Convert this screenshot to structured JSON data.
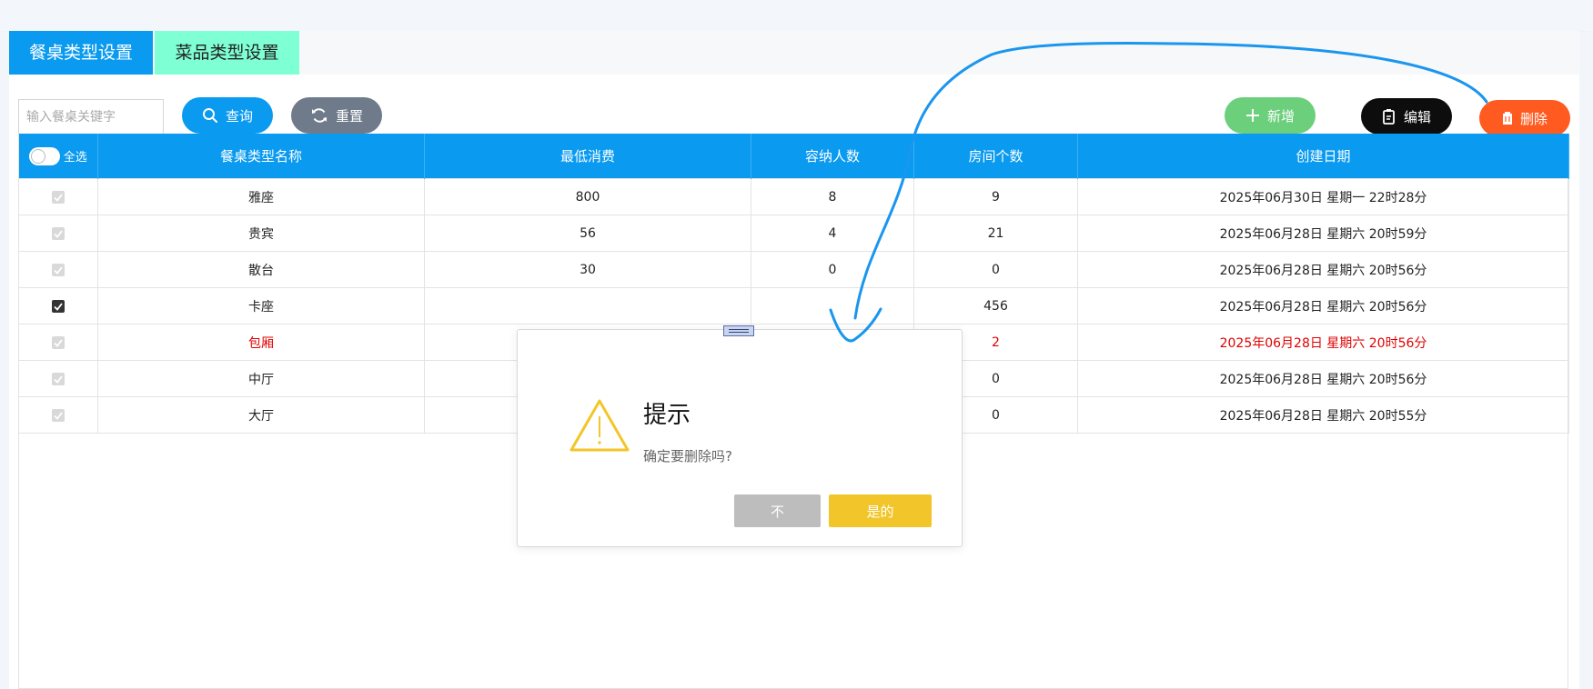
{
  "tabs": [
    {
      "label": "餐桌类型设置",
      "active": true
    },
    {
      "label": "菜品类型设置",
      "active": false
    }
  ],
  "search": {
    "placeholder": "输入餐桌关键字",
    "value": ""
  },
  "toolbar": {
    "query_label": "查询",
    "reset_label": "重置",
    "add_label": "新增",
    "edit_label": "编辑",
    "delete_label": "删除"
  },
  "table": {
    "select_all_label": "全选",
    "columns": [
      "餐桌类型名称",
      "最低消费",
      "容纳人数",
      "房间个数",
      "创建日期"
    ],
    "rows": [
      {
        "name": "雅座",
        "min_spend": "800",
        "capacity": "8",
        "rooms": "9",
        "created": "2025年06月30日 星期一 22时28分",
        "checked": false,
        "highlight": false
      },
      {
        "name": "贵宾",
        "min_spend": "56",
        "capacity": "4",
        "rooms": "21",
        "created": "2025年06月28日 星期六 20时59分",
        "checked": false,
        "highlight": false
      },
      {
        "name": "散台",
        "min_spend": "30",
        "capacity": "0",
        "rooms": "0",
        "created": "2025年06月28日 星期六 20时56分",
        "checked": false,
        "highlight": false
      },
      {
        "name": "卡座",
        "min_spend": "",
        "capacity": "",
        "rooms": "456",
        "created": "2025年06月28日 星期六 20时56分",
        "checked": true,
        "highlight": false
      },
      {
        "name": "包厢",
        "min_spend": "",
        "capacity": "",
        "rooms": "2",
        "created": "2025年06月28日 星期六 20时56分",
        "checked": false,
        "highlight": true
      },
      {
        "name": "中厅",
        "min_spend": "",
        "capacity": "",
        "rooms": "0",
        "created": "2025年06月28日 星期六 20时56分",
        "checked": false,
        "highlight": false
      },
      {
        "name": "大厅",
        "min_spend": "",
        "capacity": "",
        "rooms": "0",
        "created": "2025年06月28日 星期六 20时55分",
        "checked": false,
        "highlight": false
      }
    ]
  },
  "dialog": {
    "title": "提示",
    "message": "确定要删除吗?",
    "no_label": "不",
    "yes_label": "是的"
  },
  "colors": {
    "primary": "#0a9af0",
    "tab_secondary": "#7fffd4",
    "reset": "#6f7b8a",
    "add": "#6bcf7c",
    "edit": "#0d0d0d",
    "delete": "#ff5a1f",
    "highlight_row": "#e00000",
    "dialog_yes": "#f2c62a",
    "dialog_no": "#bdbdbd",
    "annotation_stroke": "#1a96ee"
  }
}
